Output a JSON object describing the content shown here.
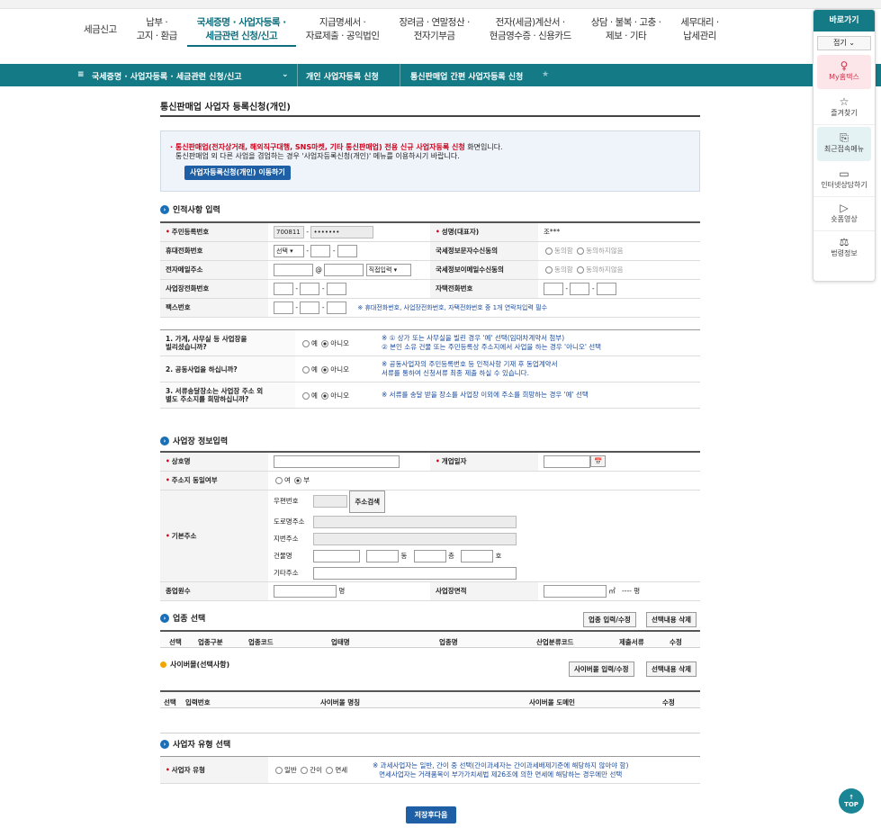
{
  "gnb": [
    "세금신고",
    "납부 ·\n고지 · 환급",
    "국세증명 · 사업자등록 ·\n세금관련 신청/신고",
    "지급명세서 ·\n자료제출 · 공익법인",
    "장려금 · 연말정산 ·\n전자기부금",
    "전자(세금)계산서 ·\n현금영수증 · 신용카드",
    "상담 · 불복 · 고충 ·\n제보 · 기타",
    "세무대리 ·\n납세관리"
  ],
  "breadcrumb": {
    "menu_icon": "≡",
    "b1": "국세증명 · 사업자등록 · 세금관련 신청/신고",
    "b2": "개인 사업자등록 신청",
    "b3": "통신판매업 간편 사업자등록 신청",
    "star": "★"
  },
  "quick": {
    "title": "바로가기",
    "fold": "접기 ⌄",
    "items": [
      "My홈택스",
      "즐겨찾기",
      "최근접속메뉴",
      "인터넷상담하기",
      "숏폼영상",
      "법령정보"
    ]
  },
  "page_title": "통신판매업 사업자 등록신청(개인)",
  "notice": {
    "line1_red": "통신판매업(전자상거래, 해외직구대행, SNS마켓, 기타 통신판매업) 전용 신규 사업자등록 신청",
    "line1_tail": " 화면입니다.",
    "line2": "통신판매업 외 다른 사업을 겸업하는 경우 '사업자등록신청(개인)' 메뉴를 이용하시기 바랍니다.",
    "button": "사업자등록신청(개인) 이동하기"
  },
  "sec1": "인적사항 입력",
  "personal": {
    "rrn_label": "주민등록번호",
    "rrn1": "700811",
    "rrn2": "•••••••",
    "name_label": "성명(대표자)",
    "name_val": "조***",
    "mobile_label": "휴대전화번호",
    "mobile_sel": "선택",
    "email_label": "전자메일주소",
    "email_sel": "직접입력",
    "sms_label": "국세정보문자수신동의",
    "email_agree_label": "국세정보이메일수신동의",
    "agree": "동의함",
    "disagree": "동의하지않음",
    "biz_phone_label": "사업장전화번호",
    "home_phone_label": "자택전화번호",
    "fax_label": "팩스번호",
    "phone_note": "※ 휴대전화번호, 사업장전화번호, 자택전화번호 중 1개 연락처입력 필수"
  },
  "questions": [
    {
      "q": "1. 가게, 사무실 등 사업장을\n빌리셨습니까?",
      "note": "※ ① 상가 또는 사무실을 빌린 경우 '예' 선택(임대차계약서 첨부)\n   ② 본인 소유 건물 또는 주민등록상 주소지에서 사업을 하는 경우 '아니오' 선택"
    },
    {
      "q": "2. 공동사업을 하십니까?",
      "note": "※ 공동사업자의 주민등록번호 등 인적사항 기재 후 동업계약서\n   서류를 통하여 신청서류 최종 제출 하실 수 있습니다."
    },
    {
      "q": "3. 서류송달장소는 사업장 주소 외\n별도 주소지를 희망하십니까?",
      "note": "※ 서류를 송달 받을 장소를 사업장 이외에 주소를 희망하는 경우 '예' 선택"
    }
  ],
  "yes": "예",
  "no": "아니오",
  "sec2": "사업장 정보입력",
  "biz": {
    "trade_name": "상호명",
    "open_date": "개업일자",
    "cal_icon": "📅",
    "addr_same": "주소지 동일여부",
    "addr_yes": "여",
    "addr_no": "부",
    "base_addr": "기본주소",
    "zip": "우편번호",
    "search_addr": "주소검색",
    "road": "도로명주소",
    "jibun": "지번주소",
    "building": "건물명",
    "dong": "동",
    "ho": "호",
    "floor": "층",
    "etc_addr": "기타주소",
    "employees": "종업원수",
    "emp_unit": "명",
    "area": "사업장면적",
    "area_unit": "㎡",
    "pyeong": "---- 평"
  },
  "sec3": "업종 선택",
  "industry_buttons": [
    "업종 입력/수정",
    "선택내용 삭제"
  ],
  "industry_cols": [
    "선택",
    "업종구분",
    "업종코드",
    "업태명",
    "업종명",
    "산업분류코드",
    "제출서류",
    "수정"
  ],
  "sec3b": "사이버몰(선택사항)",
  "cyber_buttons": [
    "사이버몰 입력/수정",
    "선택내용 삭제"
  ],
  "cyber_cols": [
    "선택",
    "입력번호",
    "사이버몰 명칭",
    "사이버몰 도메인",
    "수정"
  ],
  "sec4": "사업자 유형 선택",
  "biztype": {
    "label": "사업자 유형",
    "opts": [
      "일반",
      "간이",
      "면세"
    ],
    "note1": "※ 과세사업자는 일반, 간이 중 선택(간이과세자는 간이과세배제기준에 해당하지 않아야 함)",
    "note2": "   면세사업자는 거래품목이 부가가치세법 제26조에 의한 면세에 해당하는 경우에만 선택"
  },
  "save": "저장후다음",
  "top": "↑\nTOP",
  "colors": {
    "teal": "#147a86",
    "blue": "#1f5fa5",
    "red": "#d0021b"
  }
}
